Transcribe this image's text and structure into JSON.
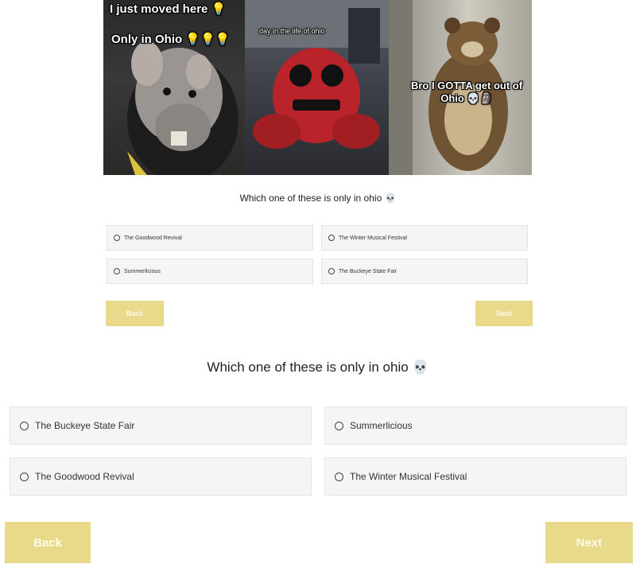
{
  "banner": {
    "panel1": {
      "caption_top": "I just moved here 💡",
      "caption_mid": "Only in Ohio 💡💡💡"
    },
    "panel2": {
      "caption": "day in the life of ohio"
    },
    "panel3": {
      "caption": "Bro I GOTTA get out of Ohio 💀🗿"
    }
  },
  "quiz_small": {
    "question": "Which one of these is only in ohio 💀",
    "options": [
      "The Goodwood Revival",
      "The Winter Musical Festival",
      "Summerlicious",
      "The Buckeye State Fair"
    ],
    "back_label": "Back",
    "next_label": "Next"
  },
  "quiz_large": {
    "question": "Which one of these is only in ohio 💀",
    "options": [
      "The Buckeye State Fair",
      "Summerlicious",
      "The Goodwood Revival",
      "The Winter Musical Festival"
    ],
    "back_label": "Back",
    "next_label": "Next"
  },
  "colors": {
    "button": "#e8d98b",
    "option_bg": "#f5f5f5"
  }
}
